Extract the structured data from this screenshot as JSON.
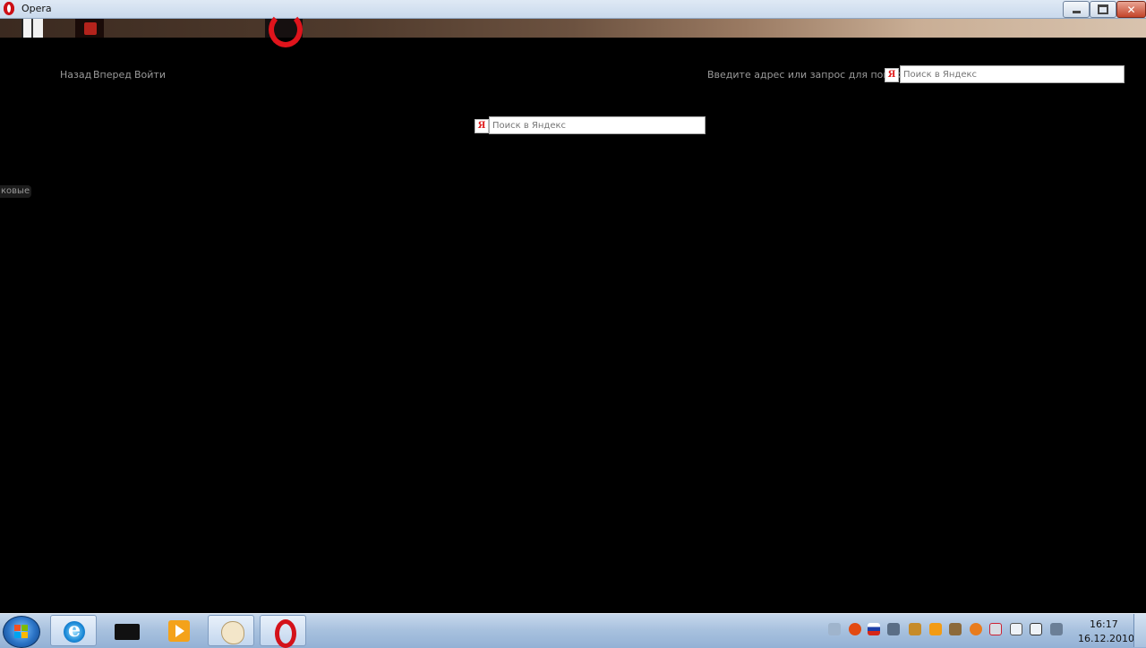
{
  "window": {
    "title": "Opera"
  },
  "nav": {
    "back": "Назад",
    "forward": "Вперед",
    "login": "Войти"
  },
  "address": {
    "label": "Введите адрес или запрос для поиска",
    "search_placeholder": "Поиск в Яндекс"
  },
  "main_search": {
    "placeholder": "Поиск в Яндекс",
    "engine_glyph": "Я"
  },
  "side_tab": {
    "label": "ковые"
  },
  "taskbar": {
    "clock_time": "16:17",
    "clock_date": "16.12.2010"
  },
  "colors": {
    "opera_red": "#cc0f16",
    "taskbar_top": "#c7d8ec",
    "taskbar_bottom": "#93b1d5"
  },
  "icons": [
    "opera-icon",
    "minimize-icon",
    "maximize-icon",
    "close-icon",
    "yandex-icon",
    "start-orb-icon",
    "ie-icon",
    "folder-icon",
    "media-player-icon",
    "paint-icon",
    "opera-taskbar-icon",
    "network-icon",
    "flash-icon",
    "language-ru-icon",
    "volume-icon",
    "device-icon",
    "media-icon",
    "tools-icon",
    "firefox-icon",
    "printer-icon",
    "usb-icon",
    "monitor-icon",
    "speaker-icon"
  ]
}
